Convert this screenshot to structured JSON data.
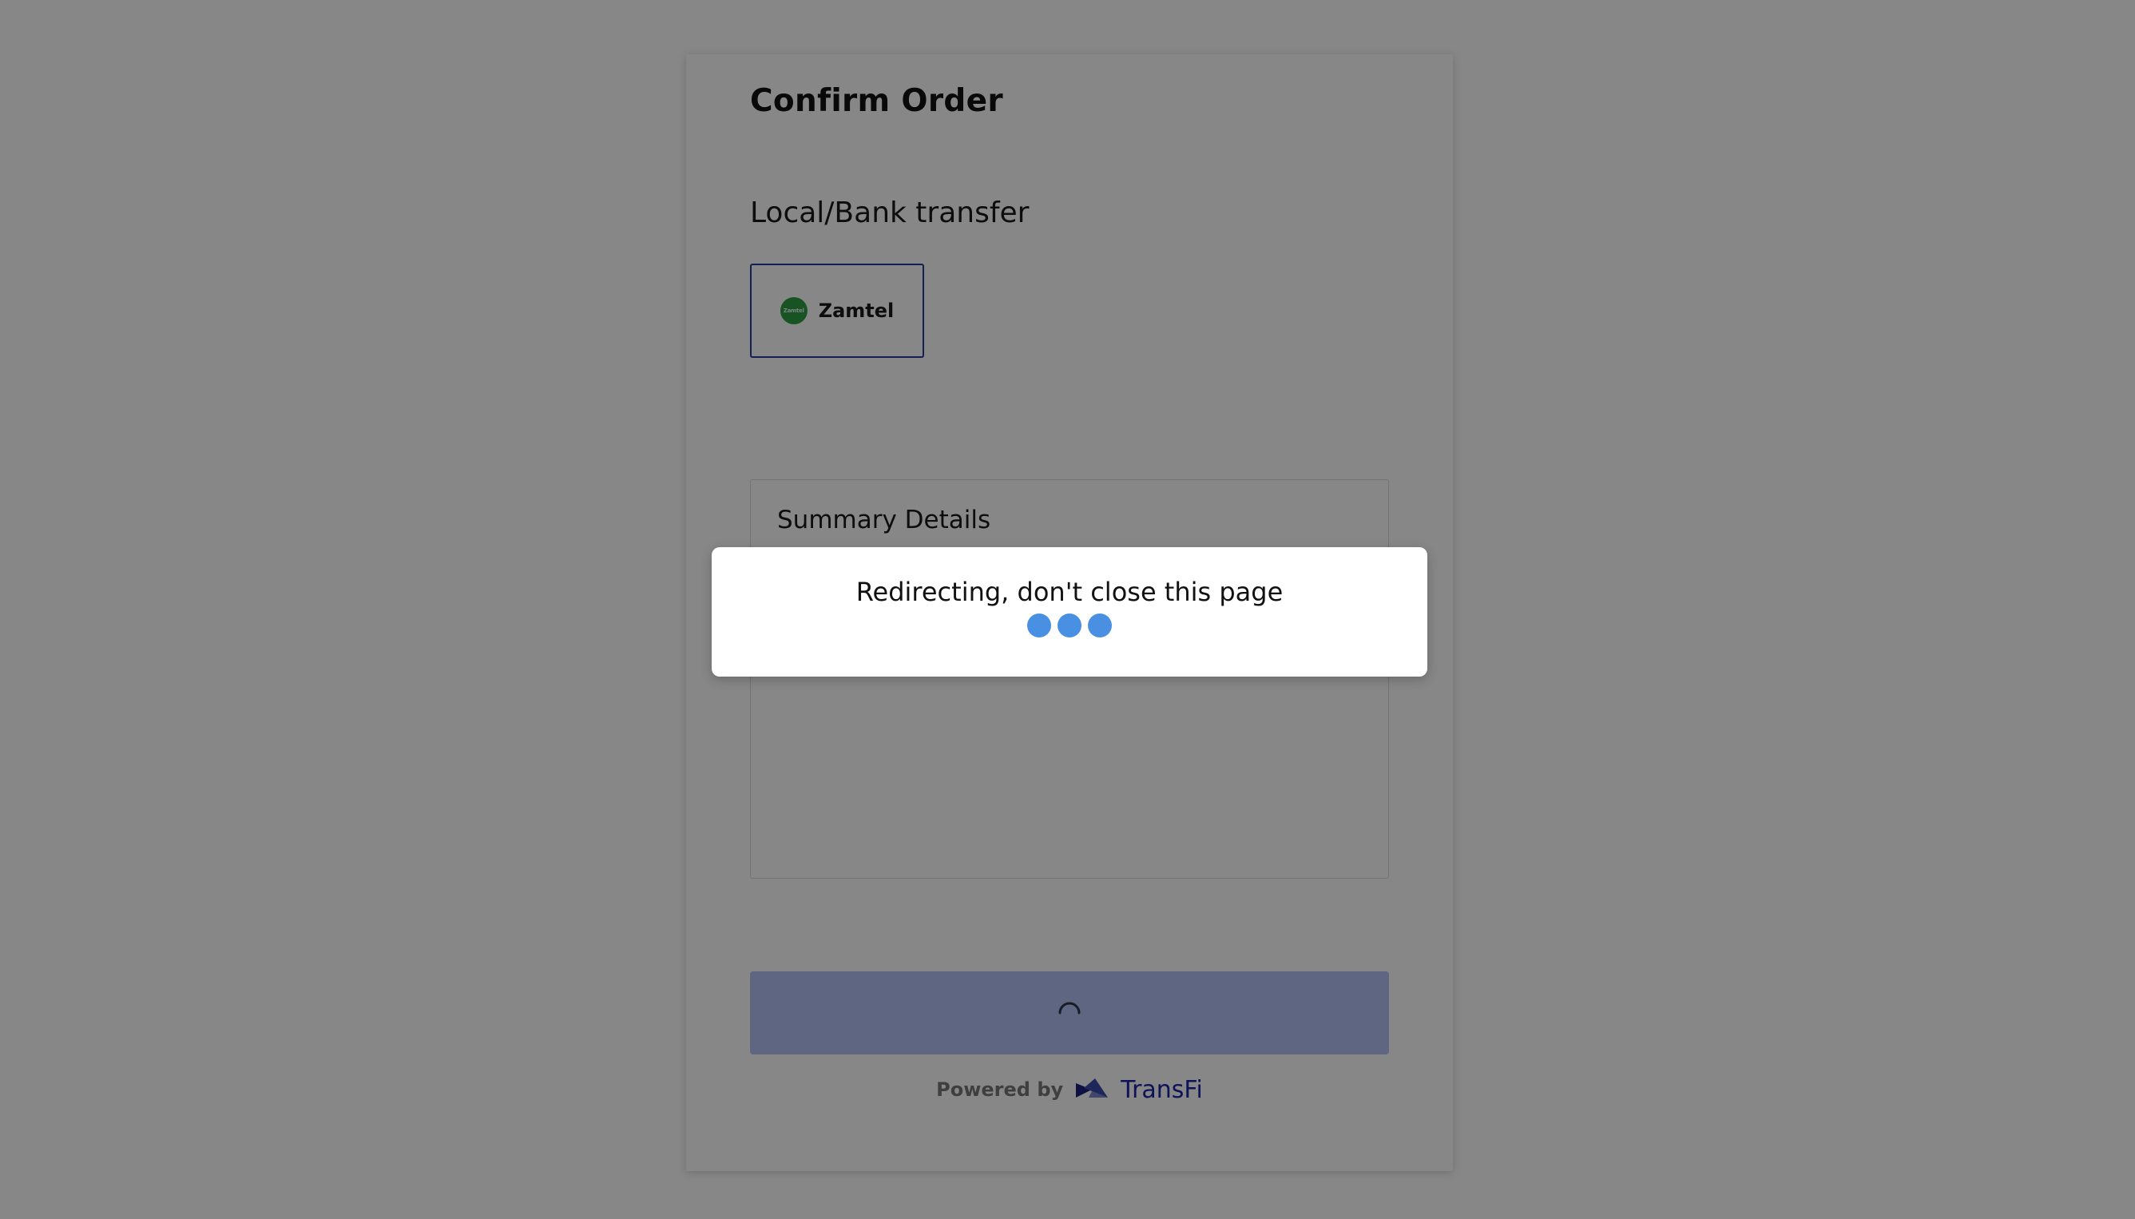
{
  "page": {
    "title": "Confirm Order"
  },
  "payment": {
    "section_title": "Local/Bank transfer",
    "method": {
      "label": "Zamtel",
      "logo_text": "Zamtel",
      "logo_icon": "zamtel-logo-icon",
      "logo_color": "#2f9e44",
      "selected": true,
      "border_color": "#283c9e"
    }
  },
  "summary": {
    "title": "Summary Details"
  },
  "confirm_button": {
    "state": "loading",
    "icon": "spinner-icon",
    "color": "#b4c0f5"
  },
  "footer": {
    "powered_by": "Powered by",
    "brand": "TransFi",
    "brand_icon": "transfi-logo-icon",
    "brand_color": "#1a23a8"
  },
  "modal": {
    "message": "Redirecting, don't close this page",
    "loader_icon": "loading-dots-icon",
    "dot_color": "#4a90e2"
  }
}
